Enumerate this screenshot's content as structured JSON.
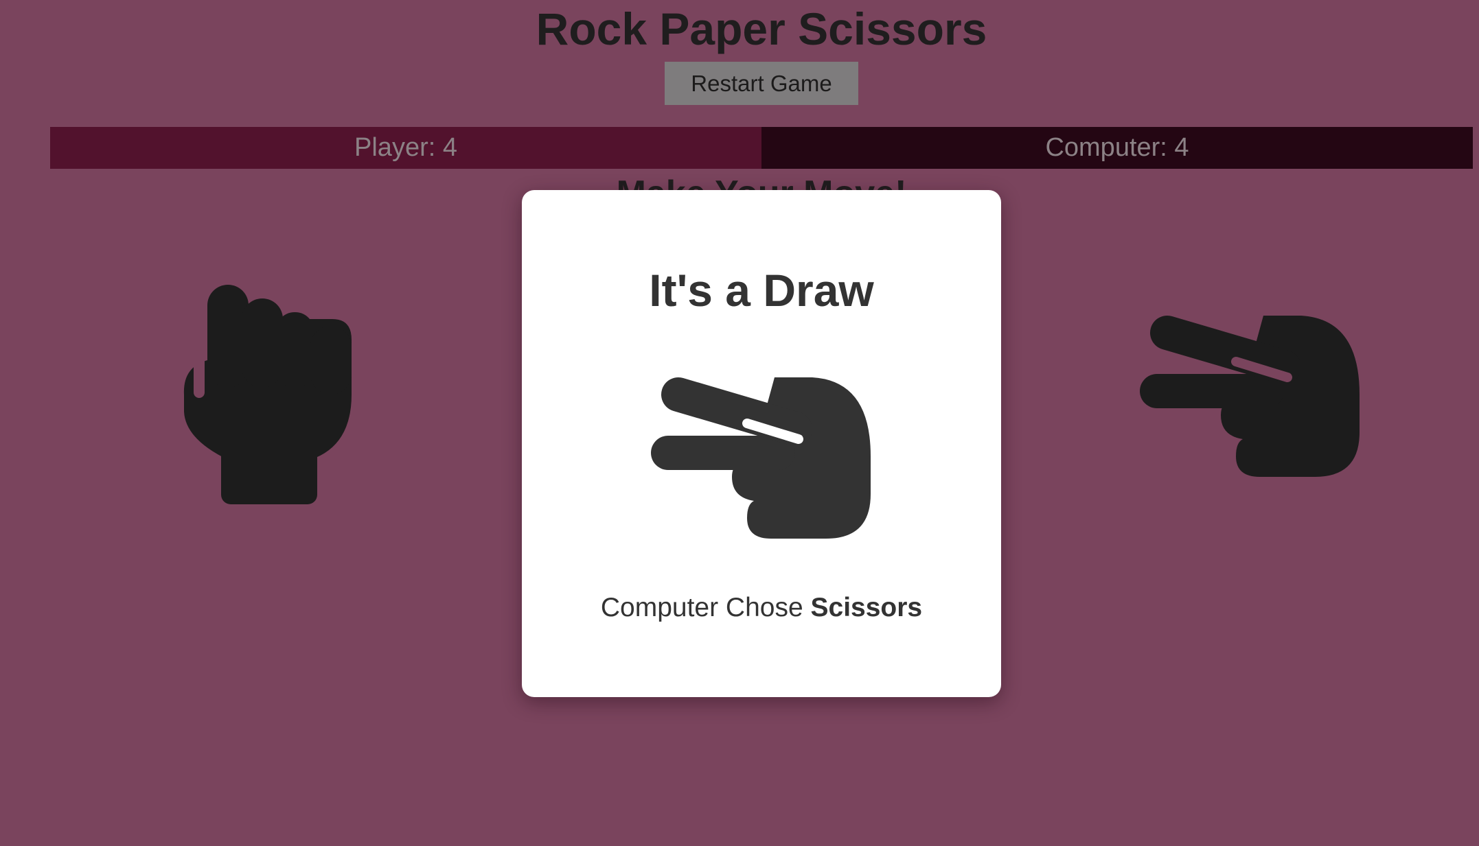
{
  "game": {
    "title": "Rock Paper Scissors",
    "restart_label": "Restart Game",
    "prompt": "Make Your Move!"
  },
  "scoreboard": {
    "player": "Player: 4",
    "computer": "Computer: 4"
  },
  "choices": [
    {
      "icon": "hand-rock-icon"
    },
    {
      "icon": "hand-scissors-icon"
    }
  ],
  "result_modal": {
    "title": "It's a Draw",
    "icon": "hand-scissors-icon",
    "text_prefix": "Computer Chose",
    "choice": "Scissors"
  },
  "colors": {
    "background": "#7a445d",
    "player_bar": "#52122d",
    "computer_bar": "#240613",
    "modal": "#ffffff",
    "icon_dark": "#1c1c1c",
    "icon_modal": "#333333"
  }
}
